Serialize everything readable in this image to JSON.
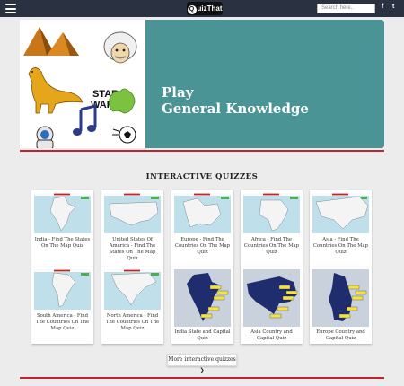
{
  "header": {
    "logo_text": "uizThat",
    "logo_letter": "Q",
    "search_placeholder": "Search here..",
    "social": [
      "f",
      "t"
    ]
  },
  "hero": {
    "title_line1": "Play",
    "title_line2": "General Knowledge",
    "star_wars_text": [
      "STAR",
      "WARS"
    ],
    "panel_color": "#4b9496"
  },
  "section": {
    "title": "INTERACTIVE QUIZZES"
  },
  "quizzes": [
    {
      "label": "India - Find The States On The Map Quiz",
      "kind": "map"
    },
    {
      "label": "United States Of America - Find The States On The Map Quiz",
      "kind": "map"
    },
    {
      "label": "Europe - Find The Countries On The Map Quiz",
      "kind": "map"
    },
    {
      "label": "Africa - Find The Countries On The Map Quiz",
      "kind": "map"
    },
    {
      "label": "Asia - Find The Countries On The Map Quiz",
      "kind": "map"
    },
    {
      "label": "South America - Find The Countries On The Map Quiz",
      "kind": "map"
    },
    {
      "label": "North America - Find The Countries On The Map Quiz",
      "kind": "map"
    },
    {
      "label": "India State and Capital Quiz",
      "kind": "capital"
    },
    {
      "label": "Asia Country and Capital Quiz",
      "kind": "capital"
    },
    {
      "label": "Europe Country and Capital Quiz",
      "kind": "capital"
    }
  ],
  "more_button": "More interactive quizzes ❯",
  "colors": {
    "topbar": "#2a3140",
    "accent_red": "#c0262f",
    "map_water": "#bfe0ea",
    "capital_land": "#1f2c6e"
  }
}
